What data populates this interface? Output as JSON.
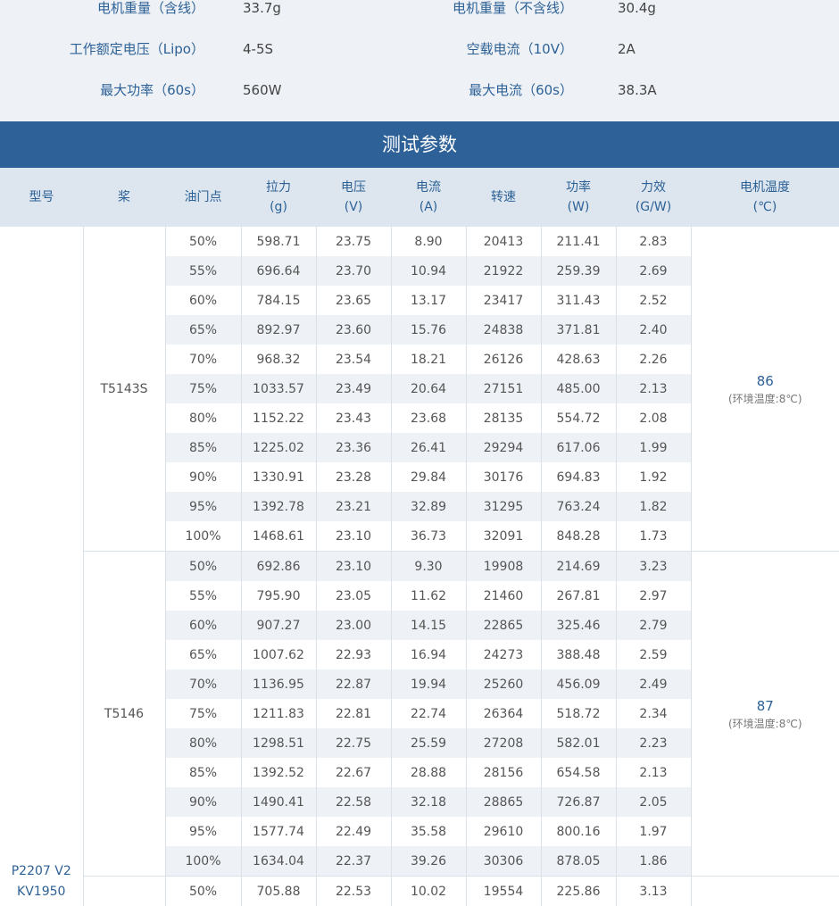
{
  "specs": [
    {
      "left_label": "电机重量（含线）",
      "left_value": "33.7g",
      "right_label": "电机重量（不含线）",
      "right_value": "30.4g"
    },
    {
      "left_label": "工作额定电压（Lipo）",
      "left_value": "4-5S",
      "right_label": "空载电流（10V）",
      "right_value": "2A"
    },
    {
      "left_label": "最大功率（60s）",
      "left_value": "560W",
      "right_label": "最大电流（60s）",
      "right_value": "38.3A"
    }
  ],
  "section_title": "测试参数",
  "headers": [
    {
      "line1": "型号",
      "line2": ""
    },
    {
      "line1": "桨",
      "line2": ""
    },
    {
      "line1": "油门点",
      "line2": ""
    },
    {
      "line1": "拉力",
      "line2": "(g)"
    },
    {
      "line1": "电压",
      "line2": "(V)"
    },
    {
      "line1": "电流",
      "line2": "(A)"
    },
    {
      "line1": "转速",
      "line2": ""
    },
    {
      "line1": "功率",
      "line2": "(W)"
    },
    {
      "line1": "力效",
      "line2": "(G/W)"
    },
    {
      "line1": "电机温度",
      "line2": "(℃)"
    }
  ],
  "model": {
    "line1": "P2207 V2",
    "line2": "KV1950"
  },
  "groups": [
    {
      "prop": "T5143S",
      "temp": "86",
      "temp_note": "(环境温度:8℃)",
      "rows": [
        [
          "50%",
          "598.71",
          "23.75",
          "8.90",
          "20413",
          "211.41",
          "2.83"
        ],
        [
          "55%",
          "696.64",
          "23.70",
          "10.94",
          "21922",
          "259.39",
          "2.69"
        ],
        [
          "60%",
          "784.15",
          "23.65",
          "13.17",
          "23417",
          "311.43",
          "2.52"
        ],
        [
          "65%",
          "892.97",
          "23.60",
          "15.76",
          "24838",
          "371.81",
          "2.40"
        ],
        [
          "70%",
          "968.32",
          "23.54",
          "18.21",
          "26126",
          "428.63",
          "2.26"
        ],
        [
          "75%",
          "1033.57",
          "23.49",
          "20.64",
          "27151",
          "485.00",
          "2.13"
        ],
        [
          "80%",
          "1152.22",
          "23.43",
          "23.68",
          "28135",
          "554.72",
          "2.08"
        ],
        [
          "85%",
          "1225.02",
          "23.36",
          "26.41",
          "29294",
          "617.06",
          "1.99"
        ],
        [
          "90%",
          "1330.91",
          "23.28",
          "29.84",
          "30176",
          "694.83",
          "1.92"
        ],
        [
          "95%",
          "1392.78",
          "23.21",
          "32.89",
          "31295",
          "763.24",
          "1.82"
        ],
        [
          "100%",
          "1468.61",
          "23.10",
          "36.73",
          "32091",
          "848.28",
          "1.73"
        ]
      ]
    },
    {
      "prop": "T5146",
      "temp": "87",
      "temp_note": "(环境温度:8℃)",
      "rows": [
        [
          "50%",
          "692.86",
          "23.10",
          "9.30",
          "19908",
          "214.69",
          "3.23"
        ],
        [
          "55%",
          "795.90",
          "23.05",
          "11.62",
          "21460",
          "267.81",
          "2.97"
        ],
        [
          "60%",
          "907.27",
          "23.00",
          "14.15",
          "22865",
          "325.46",
          "2.79"
        ],
        [
          "65%",
          "1007.62",
          "22.93",
          "16.94",
          "24273",
          "388.48",
          "2.59"
        ],
        [
          "70%",
          "1136.95",
          "22.87",
          "19.94",
          "25260",
          "456.09",
          "2.49"
        ],
        [
          "75%",
          "1211.83",
          "22.81",
          "22.74",
          "26364",
          "518.72",
          "2.34"
        ],
        [
          "80%",
          "1298.51",
          "22.75",
          "25.59",
          "27208",
          "582.01",
          "2.23"
        ],
        [
          "85%",
          "1392.52",
          "22.67",
          "28.88",
          "28156",
          "654.58",
          "2.13"
        ],
        [
          "90%",
          "1490.41",
          "22.58",
          "32.18",
          "28865",
          "726.87",
          "2.05"
        ],
        [
          "95%",
          "1577.74",
          "22.49",
          "35.58",
          "29610",
          "800.16",
          "1.97"
        ],
        [
          "100%",
          "1634.04",
          "22.37",
          "39.26",
          "30306",
          "878.05",
          "1.86"
        ]
      ]
    },
    {
      "prop": "",
      "temp": "",
      "temp_note": "",
      "rows": [
        [
          "50%",
          "705.88",
          "22.53",
          "10.02",
          "19554",
          "225.86",
          "3.13"
        ]
      ]
    }
  ]
}
